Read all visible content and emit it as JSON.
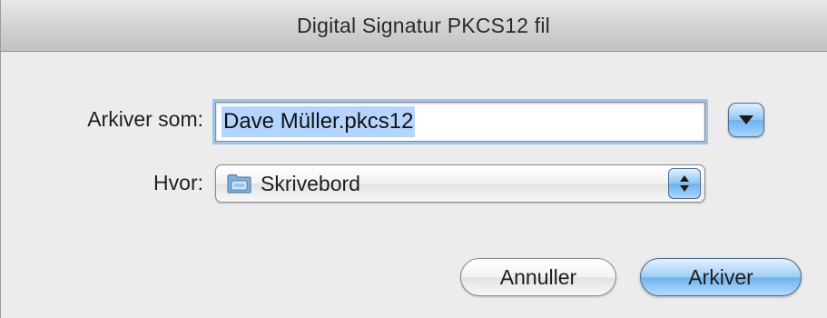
{
  "window": {
    "title": "Digital Signatur PKCS12 fil"
  },
  "form": {
    "name_label": "Arkiver som:",
    "name_value": "Dave Müller.pkcs12",
    "where_label": "Hvor:",
    "where_value": "Skrivebord",
    "where_icon": "folder-icon"
  },
  "buttons": {
    "cancel_label": "Annuller",
    "save_label": "Arkiver"
  },
  "colors": {
    "accent_blue": "#6fb1ea",
    "selection": "#b5d5ff",
    "focus_ring": "#9ec4ec"
  }
}
